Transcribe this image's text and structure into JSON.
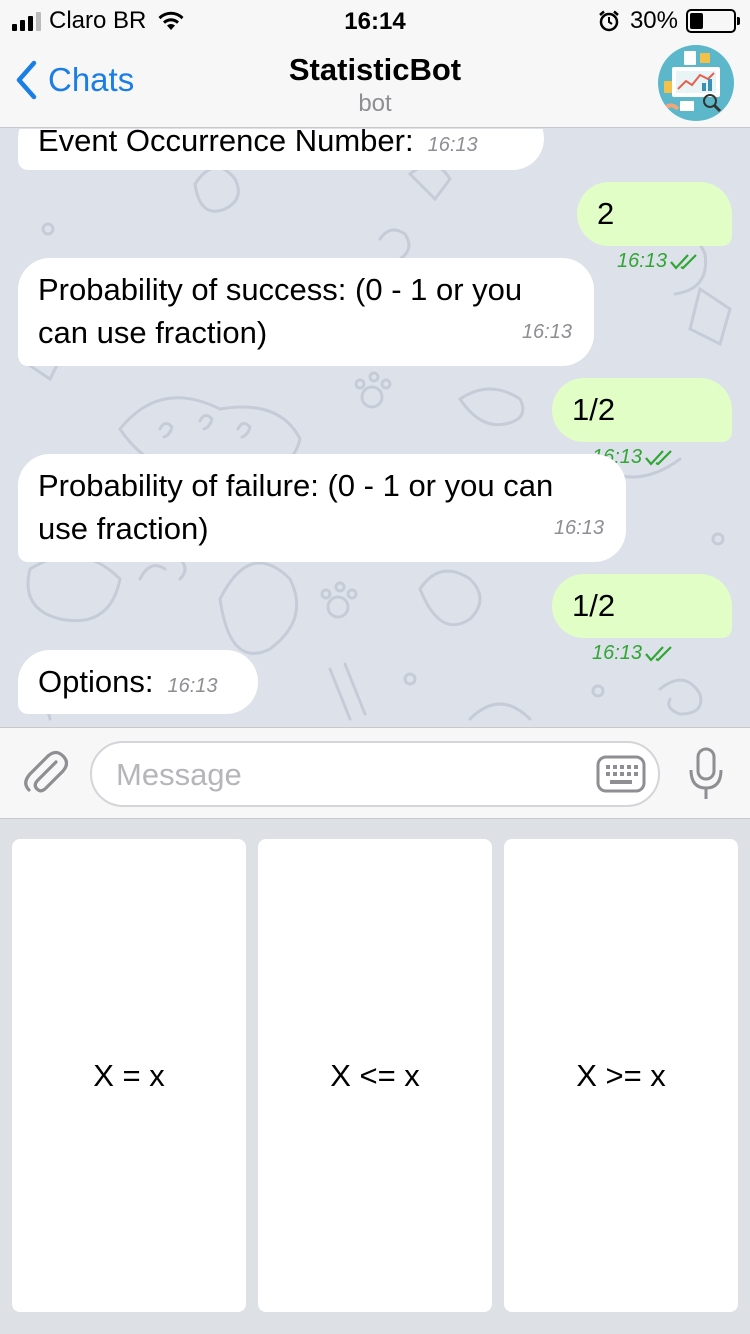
{
  "status_bar": {
    "carrier": "Claro BR",
    "time": "16:14",
    "battery_percent": "30%",
    "battery_level": 0.3
  },
  "nav": {
    "back_label": "Chats",
    "title": "StatisticBot",
    "subtitle": "bot"
  },
  "messages": [
    {
      "direction": "in",
      "text": "Event Occurrence Number:",
      "time": "16:13"
    },
    {
      "direction": "out",
      "text": "2",
      "time": "16:13"
    },
    {
      "direction": "in",
      "text": "Probability of success: (0 - 1 or you can use fraction)",
      "time": "16:13"
    },
    {
      "direction": "out",
      "text": "1/2",
      "time": "16:13"
    },
    {
      "direction": "in",
      "text": "Probability of failure: (0 - 1 or you can use fraction)",
      "time": "16:13"
    },
    {
      "direction": "out",
      "text": "1/2",
      "time": "16:13"
    },
    {
      "direction": "in",
      "text": "Options:",
      "time": "16:13"
    }
  ],
  "input": {
    "placeholder": "Message"
  },
  "keyboard": {
    "buttons": [
      "X = x",
      "X <= x",
      "X >= x"
    ]
  },
  "colors": {
    "accent": "#1a7ee6",
    "outgoing_bubble": "#e1fec6",
    "read_check": "#31a634"
  }
}
